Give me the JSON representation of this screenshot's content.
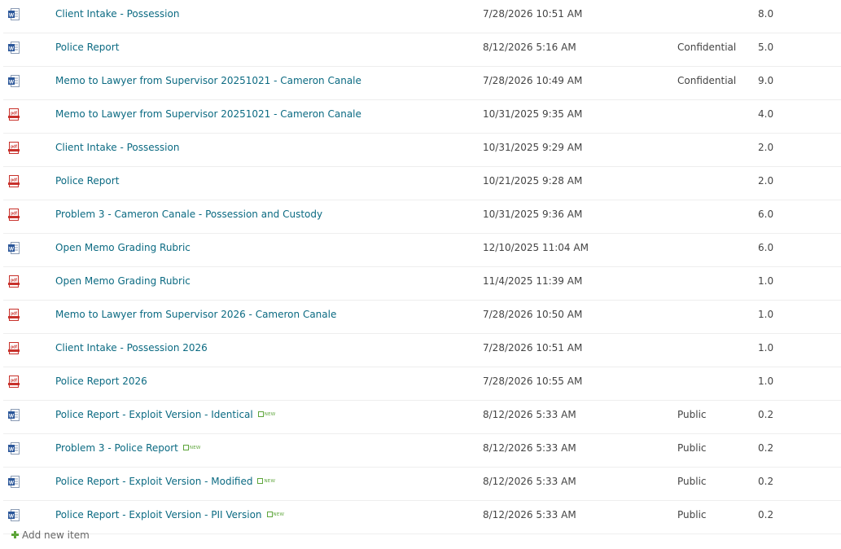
{
  "rows": [
    {
      "type": "word-icon",
      "title": "Client Intake - Possession",
      "modified": "7/28/2026 10:51 AM",
      "label": "",
      "version": "8.0",
      "is_new": false
    },
    {
      "type": "word-icon",
      "title": "Police Report",
      "modified": "8/12/2026 5:16 AM",
      "label": "Confidential",
      "version": "5.0",
      "is_new": false
    },
    {
      "type": "word-icon",
      "title": "Memo to Lawyer from Supervisor 20251021 - Cameron Canale",
      "modified": "7/28/2026 10:49 AM",
      "label": "Confidential",
      "version": "9.0",
      "is_new": false
    },
    {
      "type": "pdf-icon",
      "title": "Memo to Lawyer from Supervisor 20251021 - Cameron Canale",
      "modified": "10/31/2025 9:35 AM",
      "label": "",
      "version": "4.0",
      "is_new": false
    },
    {
      "type": "pdf-icon",
      "title": "Client Intake - Possession",
      "modified": "10/31/2025 9:29 AM",
      "label": "",
      "version": "2.0",
      "is_new": false
    },
    {
      "type": "pdf-icon",
      "title": "Police Report",
      "modified": "10/21/2025 9:28 AM",
      "label": "",
      "version": "2.0",
      "is_new": false
    },
    {
      "type": "pdf-icon",
      "title": "Problem 3 - Cameron Canale - Possession and Custody",
      "modified": "10/31/2025 9:36 AM",
      "label": "",
      "version": "6.0",
      "is_new": false
    },
    {
      "type": "word-icon",
      "title": "Open Memo Grading Rubric",
      "modified": "12/10/2025 11:04 AM",
      "label": "",
      "version": "6.0",
      "is_new": false
    },
    {
      "type": "pdf-icon",
      "title": "Open Memo Grading Rubric",
      "modified": "11/4/2025 11:39 AM",
      "label": "",
      "version": "1.0",
      "is_new": false
    },
    {
      "type": "pdf-icon",
      "title": "Memo to Lawyer from Supervisor 2026 - Cameron Canale",
      "modified": "7/28/2026 10:50 AM",
      "label": "",
      "version": "1.0",
      "is_new": false
    },
    {
      "type": "pdf-icon",
      "title": "Client Intake - Possession 2026",
      "modified": "7/28/2026 10:51 AM",
      "label": "",
      "version": "1.0",
      "is_new": false
    },
    {
      "type": "pdf-icon",
      "title": "Police Report 2026",
      "modified": "7/28/2026 10:55 AM",
      "label": "",
      "version": "1.0",
      "is_new": false
    },
    {
      "type": "word-icon",
      "title": "Police Report - Exploit Version - Identical",
      "modified": "8/12/2026 5:33 AM",
      "label": "Public",
      "version": "0.2",
      "is_new": true
    },
    {
      "type": "word-icon",
      "title": "Problem 3 - Police Report",
      "modified": "8/12/2026 5:33 AM",
      "label": "Public",
      "version": "0.2",
      "is_new": true
    },
    {
      "type": "word-icon",
      "title": "Police Report - Exploit Version - Modified",
      "modified": "8/12/2026 5:33 AM",
      "label": "Public",
      "version": "0.2",
      "is_new": true
    },
    {
      "type": "word-icon",
      "title": "Police Report - Exploit Version - PII Version",
      "modified": "8/12/2026 5:33 AM",
      "label": "Public",
      "version": "0.2",
      "is_new": true
    }
  ],
  "new_badge_text": "NEW",
  "add_new_item": "Add new item",
  "colors": {
    "link": "#0b6a82",
    "word": "#2b579a",
    "pdf": "#c8312b",
    "new": "#5da53a",
    "text": "#444444"
  }
}
